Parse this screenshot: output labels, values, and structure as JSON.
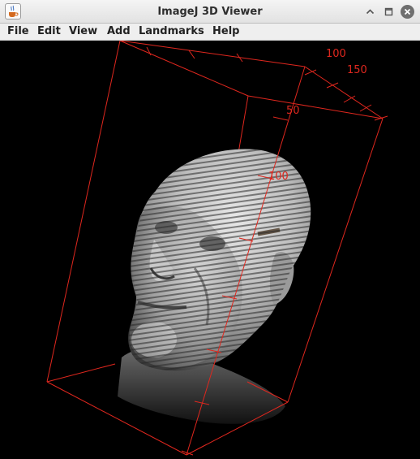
{
  "window": {
    "title": "ImageJ 3D Viewer",
    "app_icon": "java-cup-icon",
    "controls": [
      "maximize-icon",
      "restore-icon",
      "close-icon"
    ]
  },
  "menubar": {
    "items": [
      {
        "label": "File"
      },
      {
        "label": "Edit"
      },
      {
        "label": "View"
      },
      {
        "label": "Add"
      },
      {
        "label": "Landmarks"
      },
      {
        "label": "Help"
      }
    ]
  },
  "viewer": {
    "background": "#000000",
    "bounding_box_color": "#e0271e",
    "rendered_object": "volume rendering of a human head",
    "axis_labels": {
      "top_axis_100": "100",
      "top_axis_150": "150",
      "right_axis_50": "50",
      "vertical_axis_100": "100"
    }
  }
}
